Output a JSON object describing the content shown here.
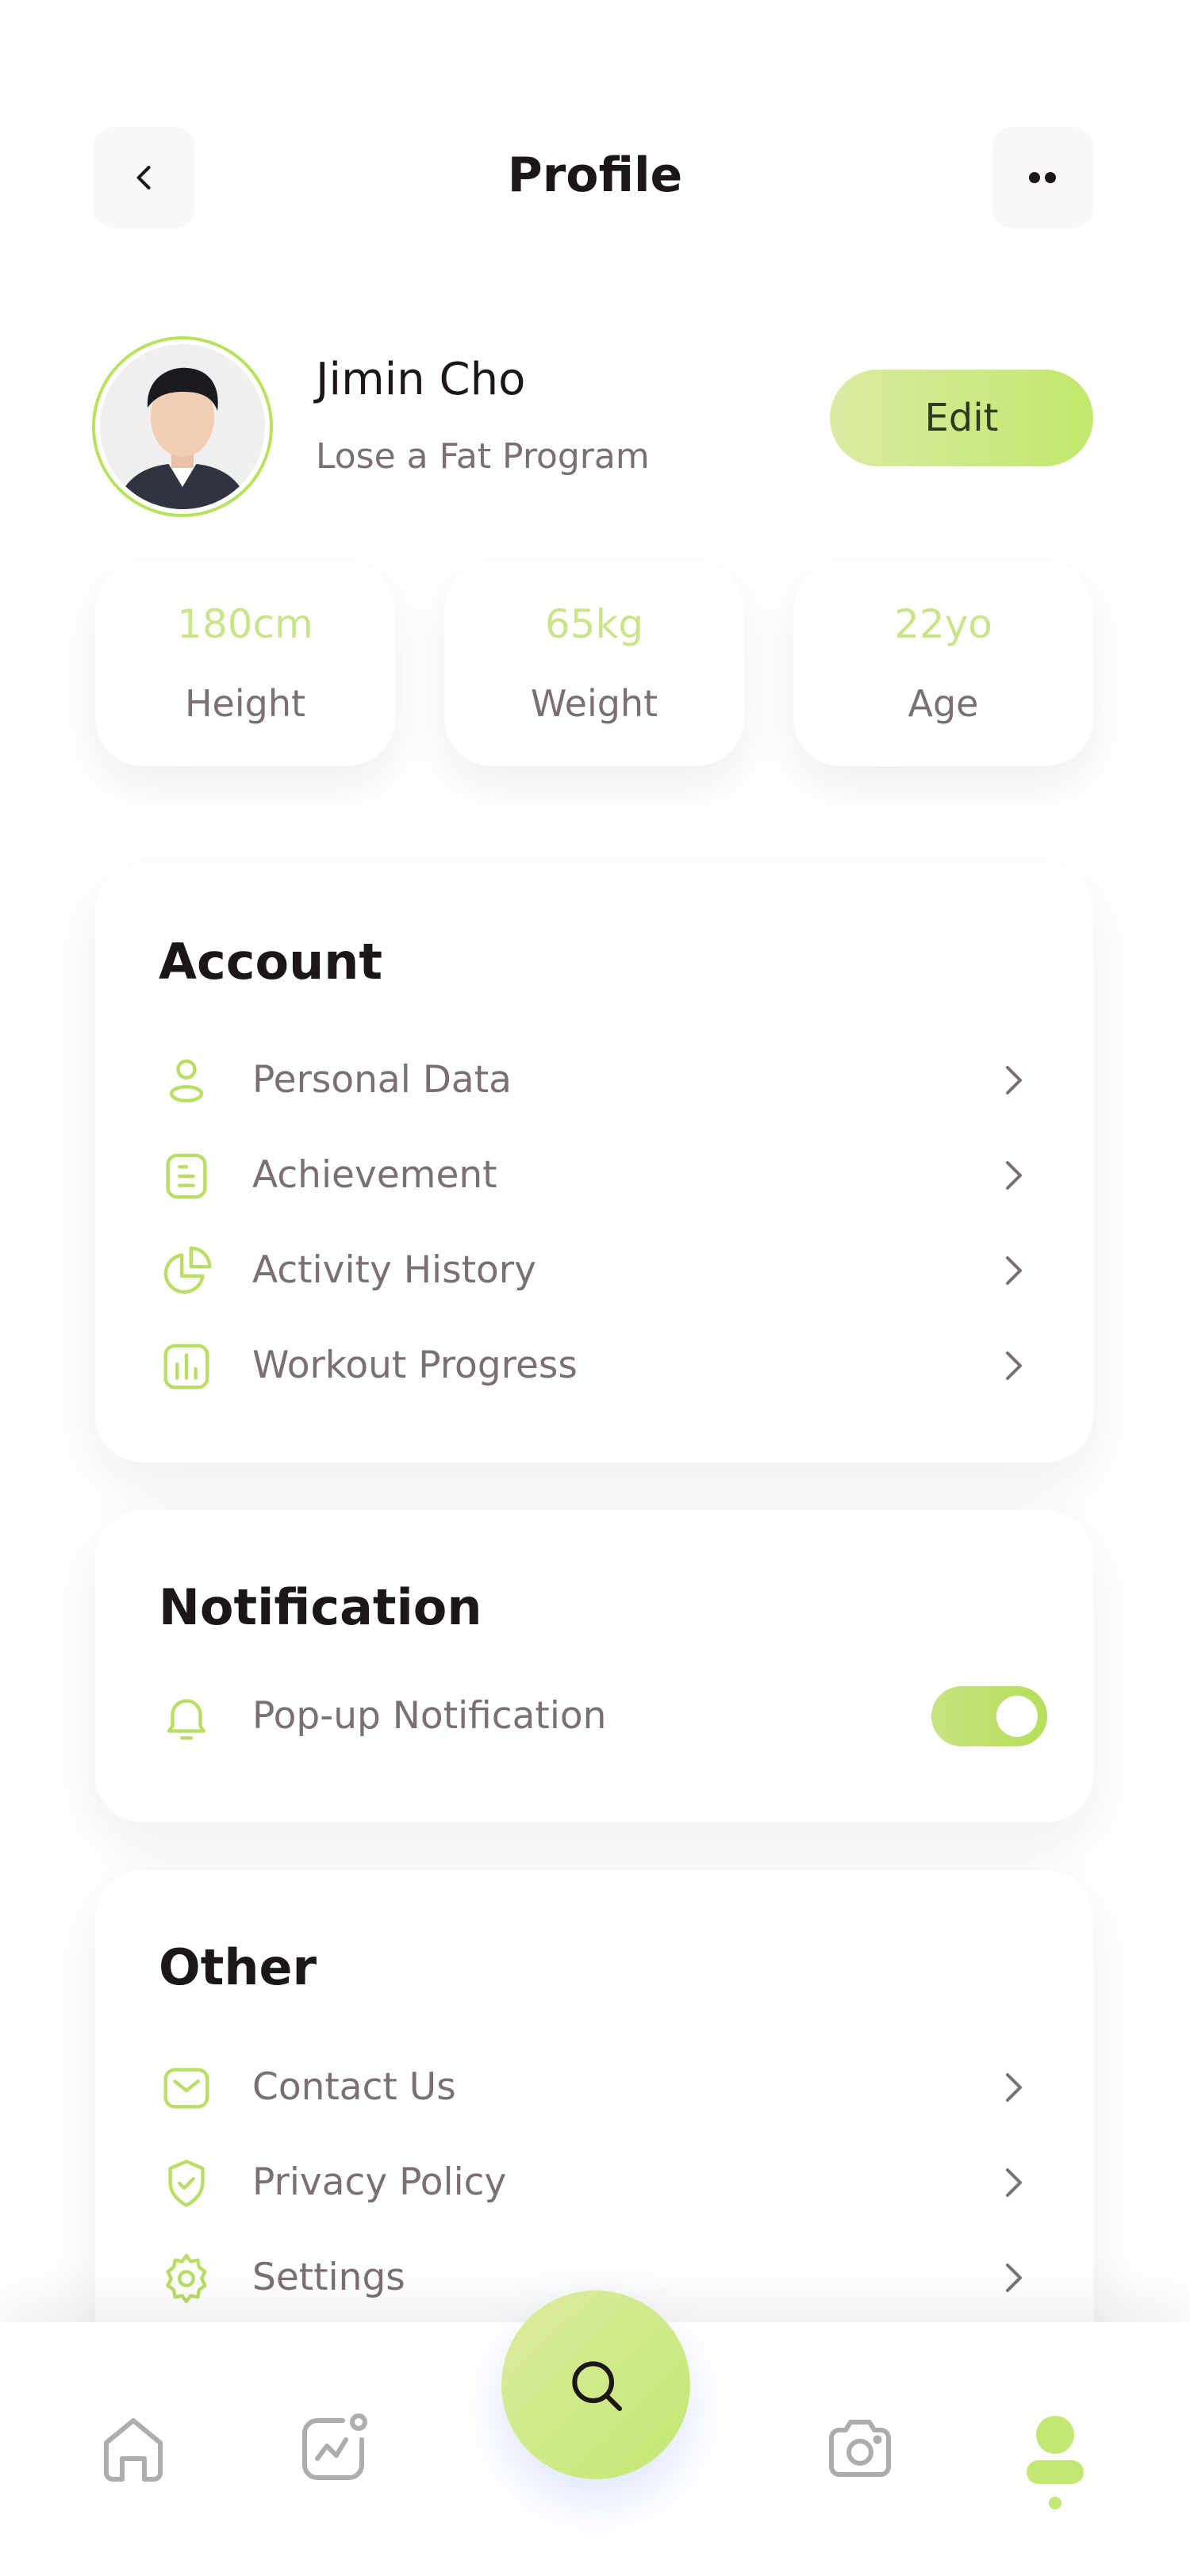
{
  "header": {
    "title": "Profile",
    "back_icon": "chevron-left-icon",
    "more_icon": "more-dots-icon"
  },
  "profile": {
    "name": "Jimin Cho",
    "program": "Lose a Fat Program",
    "edit_label": "Edit"
  },
  "stats": [
    {
      "value": "180cm",
      "label": "Height"
    },
    {
      "value": "65kg",
      "label": "Weight"
    },
    {
      "value": "22yo",
      "label": "Age"
    }
  ],
  "account": {
    "title": "Account",
    "items": [
      {
        "label": "Personal Data",
        "icon": "user-icon"
      },
      {
        "label": "Achievement",
        "icon": "document-icon"
      },
      {
        "label": "Activity History",
        "icon": "pie-chart-icon"
      },
      {
        "label": "Workout Progress",
        "icon": "bar-chart-icon"
      }
    ]
  },
  "notification": {
    "title": "Notification",
    "items": [
      {
        "label": "Pop-up Notification",
        "icon": "bell-icon",
        "enabled": true
      }
    ]
  },
  "other": {
    "title": "Other",
    "items": [
      {
        "label": "Contact Us",
        "icon": "mail-icon"
      },
      {
        "label": "Privacy Policy",
        "icon": "shield-icon"
      },
      {
        "label": "Settings",
        "icon": "gear-icon"
      }
    ]
  },
  "bottom_nav": {
    "items": [
      "home-icon",
      "activity-icon",
      "search-icon",
      "camera-icon",
      "profile-icon"
    ],
    "active": "profile-icon"
  },
  "colors": {
    "accent": "#C2E873",
    "accent_light": "#DCEAA3",
    "text_dark": "#1D1617",
    "text_gray": "#7B6F72",
    "stat_value": "#C8E58A"
  }
}
